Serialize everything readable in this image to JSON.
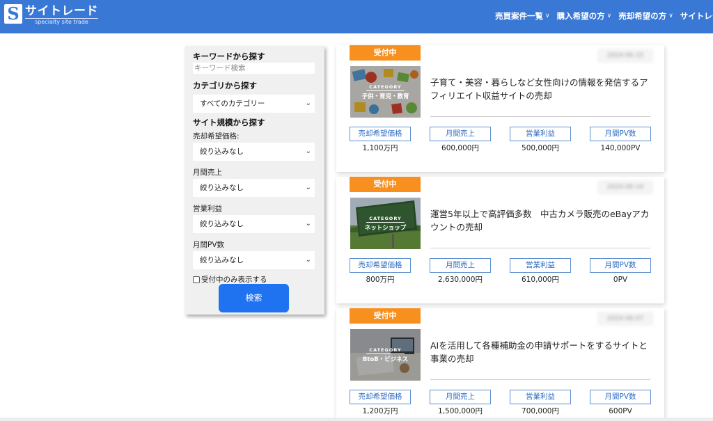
{
  "header": {
    "logo_mark": "S",
    "logo_name": "サイトレード",
    "logo_sub": "specialty site trade",
    "nav": [
      {
        "label": "売買案件一覧",
        "chevron": true
      },
      {
        "label": "購入希望の方",
        "chevron": true
      },
      {
        "label": "売却希望の方",
        "chevron": true
      },
      {
        "label": "サイトレー",
        "chevron": false
      }
    ]
  },
  "sidebar": {
    "keyword_heading": "キーワードから探す",
    "keyword_placeholder": "キーワード検索",
    "category_heading": "カテゴリから探す",
    "category_select": "すべてのカテゴリー",
    "scale_heading": "サイト規模から探す",
    "filters": [
      {
        "label": "売却希望価格:",
        "value": "絞り込みなし"
      },
      {
        "label": "月間売上",
        "value": "絞り込みなし"
      },
      {
        "label": "営業利益",
        "value": "絞り込みなし"
      },
      {
        "label": "月間PV数",
        "value": "絞り込みなし"
      }
    ],
    "open_only_label": "受付中のみ表示する",
    "search_button": "検索"
  },
  "listings": [
    {
      "status": "受付中",
      "date": "2024-06-15",
      "category_tag": "CATEGORY",
      "category": "子供・育児・教育",
      "title": "子育て・美容・暮らしなど女性向けの情報を発信するアフィリエイト収益サイトの売却",
      "metrics": [
        {
          "label": "売却希望価格",
          "value": "1,100万円"
        },
        {
          "label": "月間売上",
          "value": "600,000円"
        },
        {
          "label": "営業利益",
          "value": "500,000円"
        },
        {
          "label": "月間PV数",
          "value": "140,000PV"
        }
      ]
    },
    {
      "status": "受付中",
      "date": "2024-06-14",
      "category_tag": "CATEGORY",
      "category": "ネットショップ",
      "title": "運営5年以上で高評価多数　中古カメラ販売のeBayアカウントの売却",
      "metrics": [
        {
          "label": "売却希望価格",
          "value": "800万円"
        },
        {
          "label": "月間売上",
          "value": "2,630,000円"
        },
        {
          "label": "営業利益",
          "value": "610,000円"
        },
        {
          "label": "月間PV数",
          "value": "0PV"
        }
      ]
    },
    {
      "status": "受付中",
      "date": "2024-06-07",
      "category_tag": "CATEGORY",
      "category": "BtoB・ビジネス",
      "title": "AIを活用して各種補助金の申請サポートをするサイトと事業の売却",
      "metrics": [
        {
          "label": "売却希望価格",
          "value": "1,200万円"
        },
        {
          "label": "月間売上",
          "value": "1,500,000円"
        },
        {
          "label": "営業利益",
          "value": "700,000円"
        },
        {
          "label": "月間PV数",
          "value": "600PV"
        }
      ]
    }
  ],
  "colors": {
    "header_bg": "#3a78d6",
    "badge": "#f7901e",
    "button": "#1f73f0",
    "metric_border": "#5b8fd1"
  }
}
